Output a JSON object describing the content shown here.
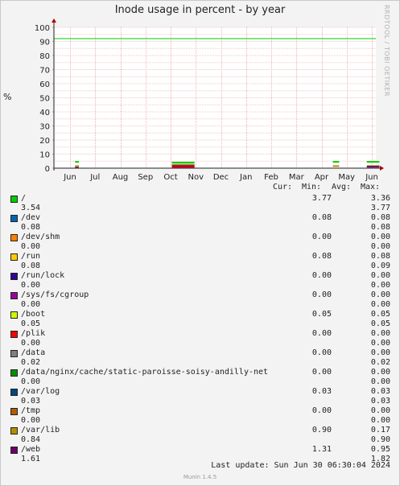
{
  "title": "Inode usage in percent - by year",
  "side_label": "RRDTOOL / TOBI OETIKER",
  "legend_header": {
    "cur": "Cur:",
    "min": "Min:",
    "avg": "Avg:",
    "max": "Max:"
  },
  "last_update": "Last update:  Sun Jun 30 06:30:04 2024",
  "version": "Munin 1.4.5",
  "chart_data": {
    "type": "line",
    "title": "Inode usage in percent - by year",
    "ylabel": "%",
    "ylim": [
      0,
      100
    ],
    "y_ticks": [
      0,
      10,
      20,
      30,
      40,
      50,
      60,
      70,
      80,
      90,
      100
    ],
    "x_ticks": [
      "Jun",
      "Jul",
      "Aug",
      "Sep",
      "Oct",
      "Nov",
      "Dec",
      "Jan",
      "Feb",
      "Mar",
      "Apr",
      "May",
      "Jun"
    ],
    "hrule": {
      "value": 92,
      "color": "#00cc00"
    },
    "grid": true,
    "visible_segments": [
      {
        "month_start": 0.2,
        "month_end": 0.35,
        "values": [
          4.5,
          1.5,
          0.3
        ]
      },
      {
        "month_start": 4.05,
        "month_end": 4.95,
        "values": [
          4.0,
          2.5,
          1.5,
          0.5
        ]
      },
      {
        "month_start": 10.45,
        "month_end": 10.7,
        "values": [
          4.5,
          1.5
        ]
      },
      {
        "month_start": 11.8,
        "month_end": 12.3,
        "values": [
          4.5,
          1.5,
          1.0
        ]
      }
    ],
    "series": [
      {
        "name": "/",
        "color": "#00cc00",
        "cur": "3.54",
        "min": "3.77",
        "avg": "3.36",
        "max": "3.77"
      },
      {
        "name": "/dev",
        "color": "#0066b3",
        "cur": "0.08",
        "min": "0.08",
        "avg": "0.08",
        "max": "0.08"
      },
      {
        "name": "/dev/shm",
        "color": "#ff8000",
        "cur": "0.00",
        "min": "0.00",
        "avg": "0.00",
        "max": "0.00"
      },
      {
        "name": "/run",
        "color": "#ffcc00",
        "cur": "0.08",
        "min": "0.08",
        "avg": "0.08",
        "max": "0.09"
      },
      {
        "name": "/run/lock",
        "color": "#330099",
        "cur": "0.00",
        "min": "0.00",
        "avg": "0.00",
        "max": "0.00"
      },
      {
        "name": "/sys/fs/cgroup",
        "color": "#990099",
        "cur": "0.00",
        "min": "0.00",
        "avg": "0.00",
        "max": "0.00"
      },
      {
        "name": "/boot",
        "color": "#ccff00",
        "cur": "0.05",
        "min": "0.05",
        "avg": "0.05",
        "max": "0.05"
      },
      {
        "name": "/plik",
        "color": "#ff0000",
        "cur": "0.00",
        "min": "0.00",
        "avg": "0.00",
        "max": "0.00"
      },
      {
        "name": "/data",
        "color": "#808080",
        "cur": "0.02",
        "min": "0.00",
        "avg": "0.00",
        "max": "0.02"
      },
      {
        "name": "/data/nginx/cache/static-paroisse-soisy-andilly-net",
        "color": "#008f00",
        "cur": "0.00",
        "min": "0.00",
        "avg": "0.00",
        "max": "0.00"
      },
      {
        "name": "/var/log",
        "color": "#00487d",
        "cur": "0.03",
        "min": "0.03",
        "avg": "0.03",
        "max": "0.03"
      },
      {
        "name": "/tmp",
        "color": "#b35a00",
        "cur": "0.00",
        "min": "0.00",
        "avg": "0.00",
        "max": "0.00"
      },
      {
        "name": "/var/lib",
        "color": "#b38f00",
        "cur": "0.84",
        "min": "0.90",
        "avg": "0.17",
        "max": "0.90"
      },
      {
        "name": "/web",
        "color": "#6b006b",
        "cur": "1.61",
        "min": "1.31",
        "avg": "0.95",
        "max": "1.82"
      }
    ]
  }
}
